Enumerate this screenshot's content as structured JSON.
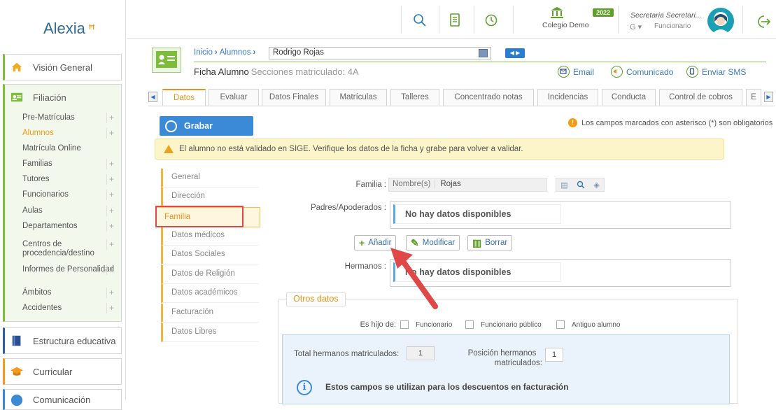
{
  "app": {
    "logo_text": "Alexia",
    "logo_mark": "ꟸ"
  },
  "sidebar": {
    "vision": "Visión General",
    "filiacion": "Filiación",
    "items": [
      {
        "label": "Pre-Matrículas",
        "plus": true
      },
      {
        "label": "Alumnos",
        "plus": true,
        "active": true
      },
      {
        "label": "Matrícula Online",
        "plus": false
      },
      {
        "label": "Familias",
        "plus": true
      },
      {
        "label": "Tutores",
        "plus": true
      },
      {
        "label": "Funcionarios",
        "plus": true
      },
      {
        "label": "Aulas",
        "plus": true
      },
      {
        "label": "Departamentos",
        "plus": true
      },
      {
        "label": "Centros de procedencia/destino",
        "plus": true
      },
      {
        "label": "Informes de Personalidad",
        "plus": true
      },
      {
        "label": "Ámbitos",
        "plus": true
      },
      {
        "label": "Accidentes",
        "plus": true
      }
    ],
    "estructura": "Estructura educativa",
    "curricular": "Curricular",
    "comunicacion": "Comunicación"
  },
  "topbar": {
    "colegio": "Colegio Demo",
    "year": "2022",
    "user_name": "Secretaria Secretari...",
    "user_role": "Funcionario",
    "g_label": "G ▾"
  },
  "header": {
    "breadcrumb": [
      "Inicio",
      "Alumnos"
    ],
    "student_select": "Rodrigo Rojas",
    "nav": "◀ ▶",
    "title": "Ficha Alumno",
    "subtitle": "Secciones matriculado: 4A",
    "actions": {
      "email": "Email",
      "comunicado": "Comunicado",
      "sms": "Enviar SMS"
    }
  },
  "tabs": [
    "Datos",
    "Evaluar",
    "Datos Finales",
    "Matrículas",
    "Talleres",
    "Concentrado notas",
    "Incidencias",
    "Conducta",
    "Control de cobros",
    "E"
  ],
  "content": {
    "grabar": "Grabar",
    "required_note": "Los campos marcados con asterisco (*) son obligatorios",
    "warning": "El alumno no está validado en SIGE. Verifique los datos de la ficha y grabe para volver a validar.",
    "sections": [
      "General",
      "Dirección",
      "Familia",
      "Datos médicos",
      "Datos Sociales",
      "Datos de Religión",
      "Datos académicos",
      "Facturación",
      "Datos Libres"
    ],
    "active_section": "Familia",
    "familia_label": "Familia :",
    "familia_prefix": "Nombre(s)",
    "familia_value": "Rojas",
    "padres_label": "Padres/Apoderados :",
    "no_data": "No hay datos disponibles",
    "btn_add": "Añadir",
    "btn_edit": "Modificar",
    "btn_delete": "Borrar",
    "hermanos_label": "Hermanos :",
    "otros_title": "Otros datos",
    "hijo_de": "Es hijo de:",
    "cb1": "Funcionario",
    "cb2": "Funcionario público",
    "cb3": "Antiguo alumno",
    "total_label": "Total hermanos matriculados:",
    "total_value": "1",
    "pos_label1": "Posición hermanos",
    "pos_label2": "matriculados:",
    "pos_value": "1",
    "info_text": "Estos campos se utilizan para los descuentos en facturación"
  },
  "colors": {
    "accent_green": "#7cbd3a",
    "accent_orange": "#e6941a",
    "primary_blue": "#3a8ad8",
    "annotation_red": "#e04848"
  }
}
